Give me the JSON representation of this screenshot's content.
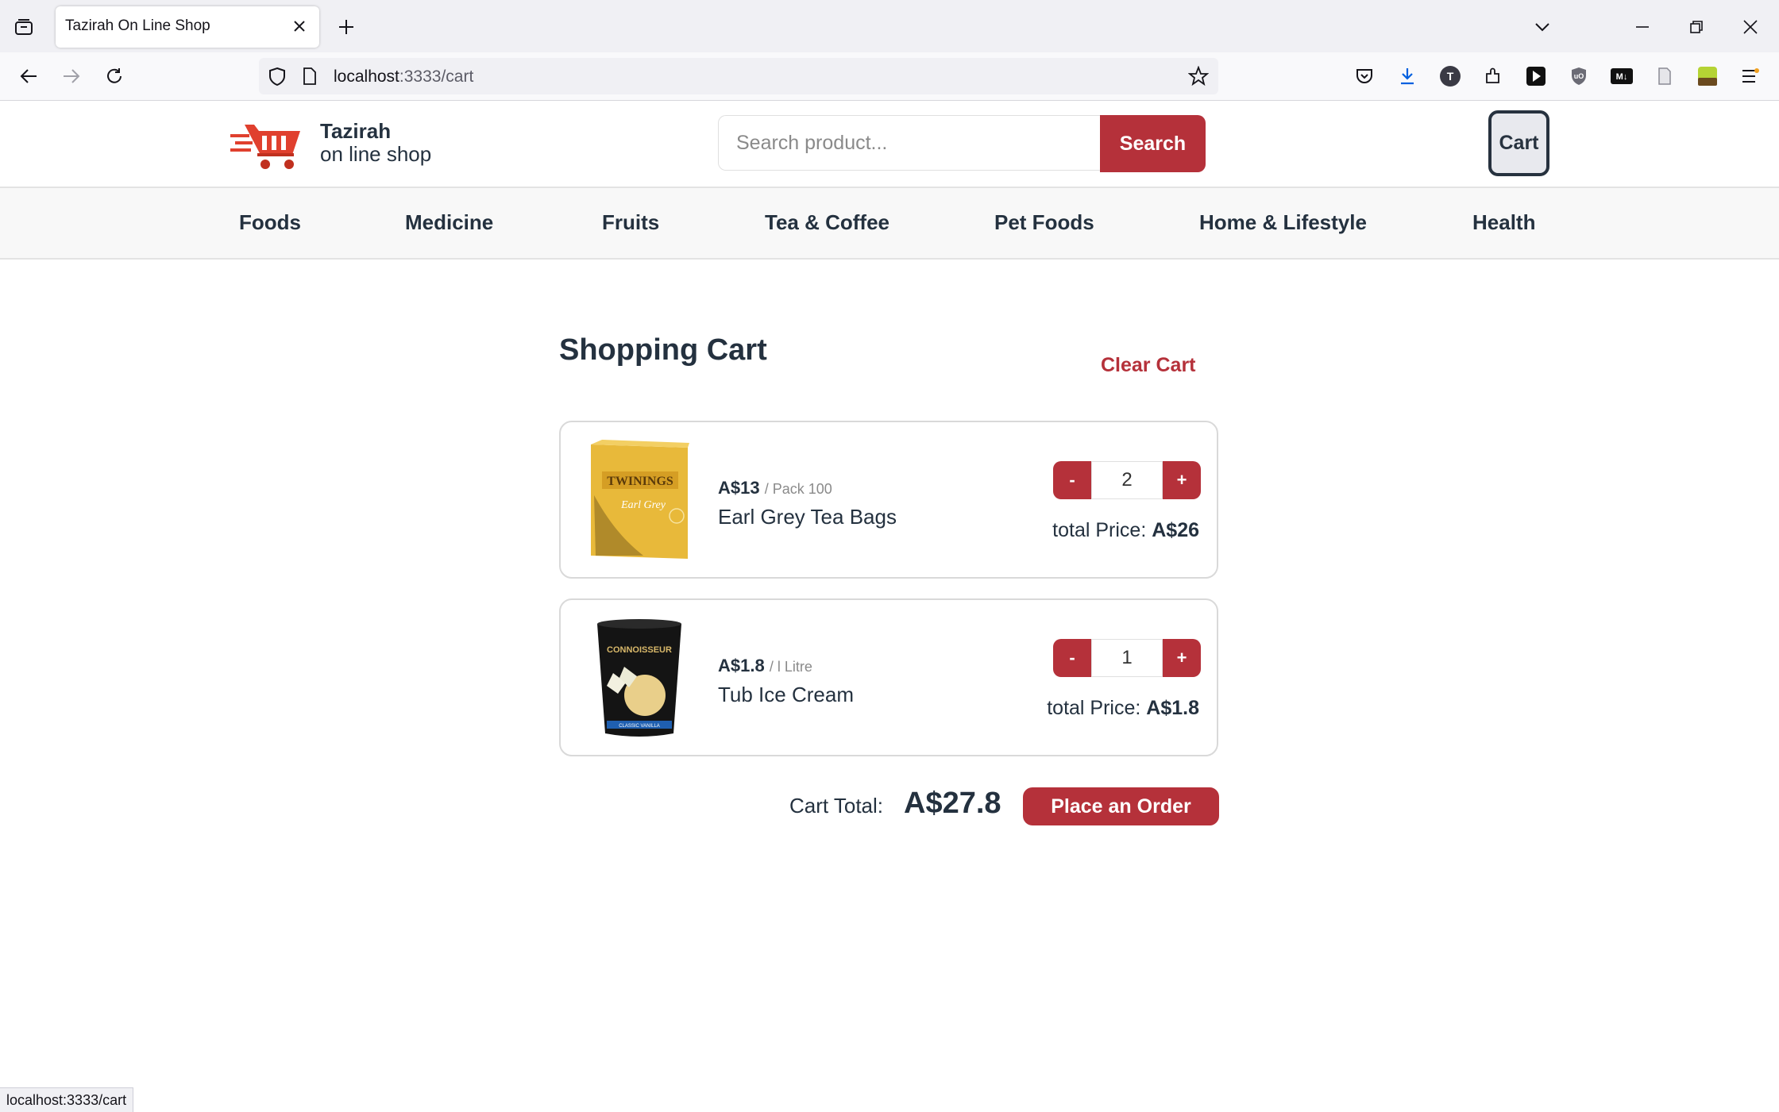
{
  "browser": {
    "tab_title": "Tazirah On Line Shop",
    "url_host": "localhost",
    "url_path": ":3333/cart",
    "status_url": "localhost:3333/cart"
  },
  "header": {
    "brand_name": "Tazirah",
    "brand_sub": "on line shop",
    "search_placeholder": "Search product...",
    "search_label": "Search",
    "cart_label": "Cart"
  },
  "categories": [
    "Foods",
    "Medicine",
    "Fruits",
    "Tea & Coffee",
    "Pet Foods",
    "Home & Lifestyle",
    "Health"
  ],
  "cart": {
    "title": "Shopping Cart",
    "clear_label": "Clear Cart",
    "items": [
      {
        "price": "A$13",
        "unit": "/ Pack 100",
        "name": "Earl Grey Tea Bags",
        "quantity": "2",
        "total_label": "total Price:",
        "total_value": "A$26",
        "minus_label": "-",
        "plus_label": "+",
        "image_brand": "TWININGS",
        "image_text": "Earl Grey"
      },
      {
        "price": "A$1.8",
        "unit": "/ l Litre",
        "name": "Tub Ice Cream",
        "quantity": "1",
        "total_label": "total Price:",
        "total_value": "A$1.8",
        "minus_label": "-",
        "plus_label": "+",
        "image_brand": "CONNOISSEUR",
        "image_text": "CLASSIC VANILLA"
      }
    ],
    "total_label": "Cart Total:",
    "total_value": "A$27.8",
    "order_label": "Place an Order"
  },
  "colors": {
    "accent": "#b5313a",
    "text": "#24313f"
  }
}
